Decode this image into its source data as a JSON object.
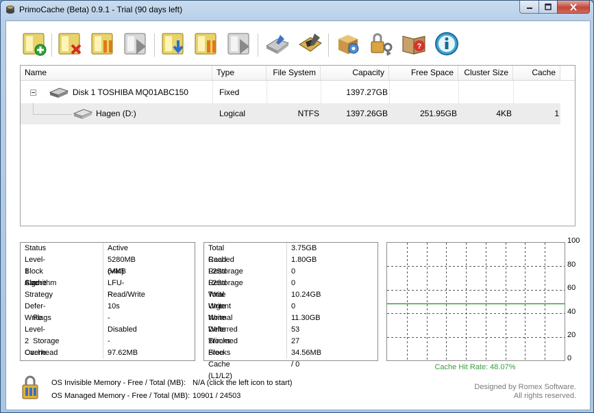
{
  "window": {
    "title": "PrimoCache (Beta) 0.9.1 - Trial (90 days left)"
  },
  "toolbar": {
    "buttons": [
      {
        "icon": "add-cache-icon"
      },
      {
        "icon": "remove-cache-icon"
      },
      {
        "icon": "pause-cache-icon"
      },
      {
        "icon": "resume-cache-icon"
      },
      {
        "icon": "load-cache-icon"
      },
      {
        "icon": "pause-all-icon"
      },
      {
        "icon": "resume-all-icon"
      },
      {
        "icon": "settings-icon"
      },
      {
        "icon": "hardware-icon"
      },
      {
        "icon": "options-icon"
      },
      {
        "icon": "license-icon"
      },
      {
        "icon": "help-icon"
      },
      {
        "icon": "about-icon"
      }
    ]
  },
  "tree": {
    "columns": [
      "Name",
      "Type",
      "File System",
      "Capacity",
      "Free Space",
      "Cluster Size",
      "Cache"
    ],
    "rows": [
      {
        "name": "Disk 1 TOSHIBA MQ01ABC150",
        "type": "Fixed",
        "fs": "",
        "capacity": "1397.27GB",
        "free": "",
        "cluster": "",
        "cache": ""
      },
      {
        "name": "Hagen (D:)",
        "type": "Logical",
        "fs": "NTFS",
        "capacity": "1397.26GB",
        "free": "251.95GB",
        "cluster": "4KB",
        "cache": "1"
      }
    ]
  },
  "status": [
    {
      "label": "Status",
      "value": "Active"
    },
    {
      "label": "Level-1 Cache",
      "value": "5280MB (VM)"
    },
    {
      "label": "Block Size",
      "value": "64KB"
    },
    {
      "label": "Algorithm",
      "value": "LFU-R"
    },
    {
      "label": "Strategy",
      "value": "Read/Write"
    },
    {
      "label": "Defer-Write",
      "value": "10s"
    },
    {
      "label": "Flags",
      "value": "-"
    },
    {
      "label": "Level-2 Cache",
      "value": "Disabled"
    },
    {
      "label": "Storage",
      "value": "-"
    },
    {
      "label": "Overhead",
      "value": "97.62MB"
    }
  ],
  "stats": [
    {
      "label": "Total Read",
      "value": "3.75GB"
    },
    {
      "label": "Cached Read",
      "value": "1.80GB"
    },
    {
      "label": "L2Storage Read",
      "value": "0"
    },
    {
      "label": "L2Storage Write",
      "value": "0"
    },
    {
      "label": "Total Write",
      "value": "10.24GB"
    },
    {
      "label": "Urgent Write",
      "value": "0"
    },
    {
      "label": "Normal Write",
      "value": "11.30GB"
    },
    {
      "label": "Deferred Blocks",
      "value": "53"
    },
    {
      "label": "Trimmed Blocks",
      "value": "27"
    },
    {
      "label": "Free Cache (L1/L2)",
      "value": "34.56MB / 0"
    }
  ],
  "chart_data": {
    "type": "line",
    "ylim": [
      0,
      100
    ],
    "yticks": [
      "100",
      "80",
      "60",
      "40",
      "20",
      "0"
    ],
    "series": [
      {
        "values": [
          48.07,
          48.07
        ]
      }
    ],
    "caption": "Cache Hit Rate: 48.07%",
    "line_color": "#3aa33a"
  },
  "footer": {
    "invisible_label": "OS Invisible Memory - Free / Total (MB):",
    "invisible_value": "N/A (click the left icon to start)",
    "managed_label": "OS Managed Memory - Free / Total (MB):",
    "managed_value": "10901 / 24503",
    "credit1": "Designed by Romex Software.",
    "credit2": "All rights reserved."
  }
}
